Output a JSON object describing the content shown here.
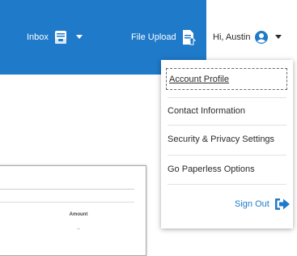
{
  "nav": {
    "inbox_label": "Inbox",
    "file_upload_label": "File Upload",
    "user_greeting": "Hi, Austin"
  },
  "dropdown": {
    "items": [
      {
        "label": "Account Profile"
      },
      {
        "label": "Contact Information"
      },
      {
        "label": "Security & Privacy Settings"
      },
      {
        "label": "Go Paperless Options"
      }
    ],
    "sign_out_label": "Sign Out"
  },
  "table": {
    "column_header": "Amount",
    "cell_value": "--"
  },
  "colors": {
    "brand_blue": "#1f7ac9",
    "white": "#ffffff"
  },
  "icons": {
    "inbox": "inbox-tray-icon",
    "file_upload": "document-upload-icon",
    "user": "user-circle-icon",
    "sign_out": "sign-out-arrow-icon"
  }
}
